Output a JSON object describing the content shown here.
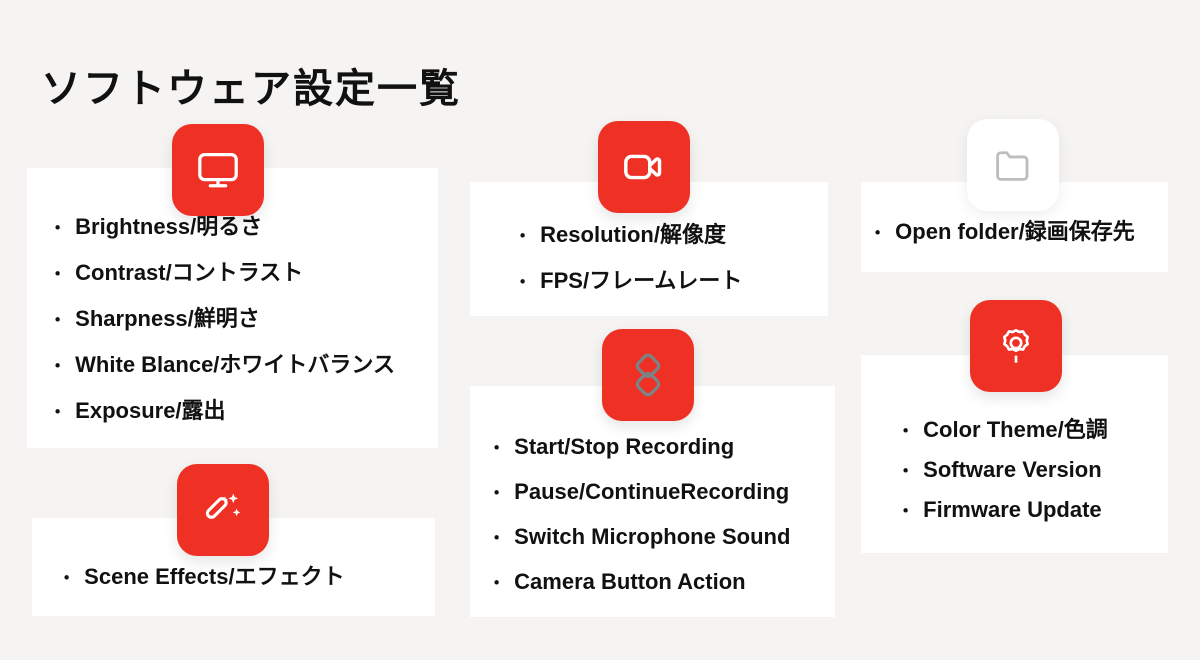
{
  "page": {
    "title": "ソフトウェア設定一覧",
    "background_color": "#f5f4f2",
    "accent_color": "#ee3124",
    "card_color": "#ffffff",
    "text_color": "#111111",
    "bullet": "・"
  },
  "cards": {
    "display": {
      "icon": "monitor-icon",
      "icon_style": "red-tile",
      "items": [
        "Brightness/明るさ",
        "Contrast/コントラスト",
        "Sharpness/鮮明さ",
        "White Blance/ホワイトバランス",
        "Exposure/露出"
      ]
    },
    "effects": {
      "icon": "magic-wand-icon",
      "icon_style": "red-tile",
      "items": [
        "Scene Effects/エフェクト"
      ]
    },
    "video": {
      "icon": "video-camera-icon",
      "icon_style": "red-tile",
      "items": [
        "Resolution/解像度",
        "FPS/フレームレート"
      ]
    },
    "recording": {
      "icon": "layers-s-icon",
      "icon_style": "red-tile",
      "items": [
        "Start/Stop Recording",
        "Pause/ContinueRecording",
        "Switch Microphone Sound",
        "Camera Button Action"
      ]
    },
    "folder": {
      "icon": "folder-icon",
      "icon_style": "white-tile",
      "items": [
        "Open folder/録画保存先"
      ]
    },
    "system": {
      "icon": "gear-icon",
      "icon_style": "red-tile",
      "items": [
        "Color Theme/色調",
        "Software Version",
        "Firmware Update"
      ]
    }
  }
}
